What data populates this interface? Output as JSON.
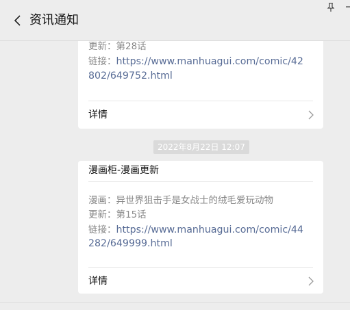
{
  "header": {
    "title": "资讯通知"
  },
  "messages": [
    {
      "update_line": "更新：第28话",
      "link_prefix": "链接：",
      "link_line1": "https://www.manhuagui.com/comic/42",
      "link_line2": "802/649752.html",
      "details_label": "详情"
    },
    {
      "timestamp": "2022年8月22日  12:07",
      "title": "漫画柜-漫画更新",
      "comic_line": "漫画：异世界狙击手是女战士的绒毛爱玩动物",
      "update_line": "更新：第15话",
      "link_prefix": "链接：",
      "link_line1": "https://www.manhuagui.com/comic/44",
      "link_line2": "282/649999.html",
      "details_label": "详情"
    }
  ],
  "icons": {
    "back": "chevron-left-icon",
    "pin": "pin-icon",
    "details": "chevron-right-icon"
  },
  "colors": {
    "background": "#ededed",
    "card": "#ffffff",
    "link": "#576b95",
    "secondary_text": "#888888",
    "timestamp_bg": "#dadada"
  }
}
